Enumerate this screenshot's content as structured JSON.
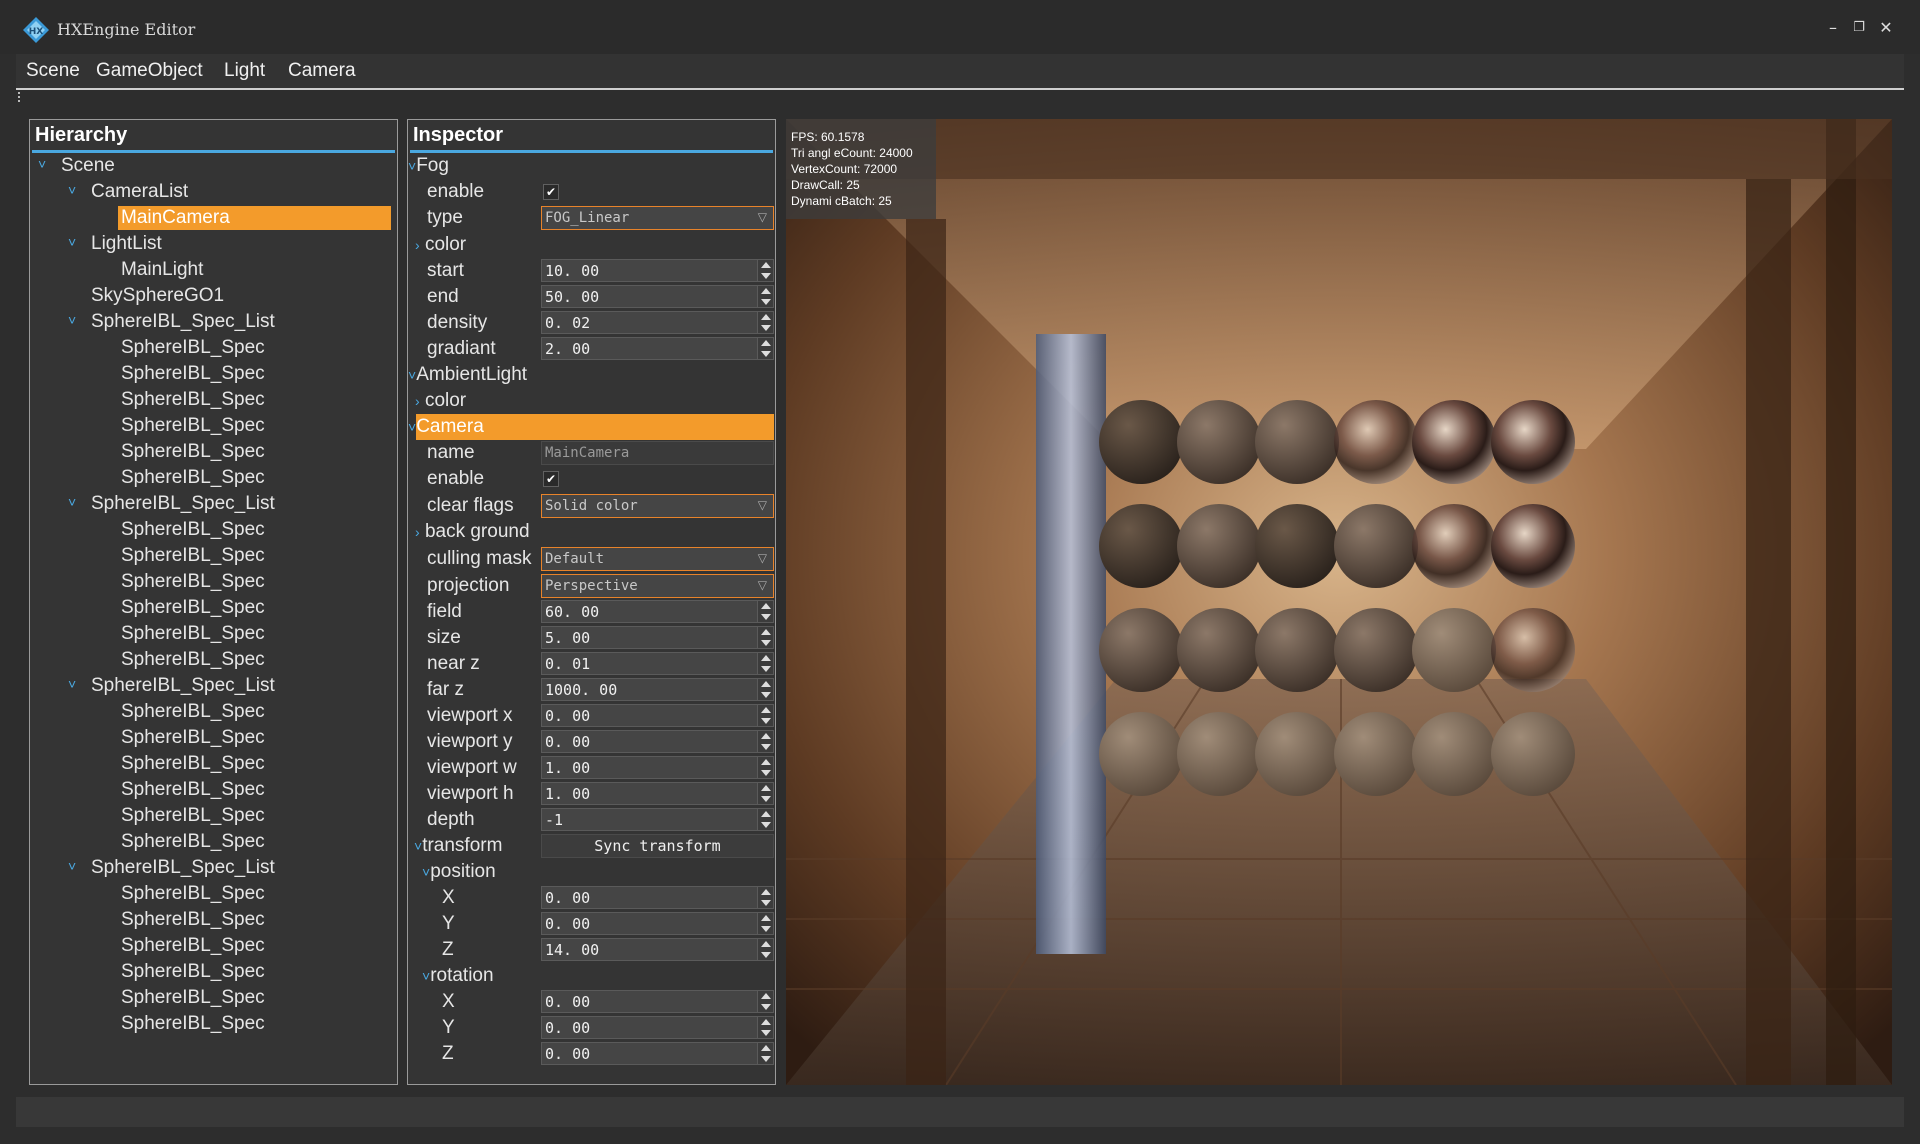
{
  "window": {
    "title": "HXEngine Editor",
    "minimize_icon": "minimize-icon",
    "restore_icon": "restore-icon",
    "close_icon": "close-icon"
  },
  "menu": [
    "Scene",
    "GameObject",
    "Light",
    "Camera"
  ],
  "hierarchy": {
    "title": "Hierarchy",
    "rows": [
      {
        "label": "Scene",
        "depth": 0,
        "expanded": true
      },
      {
        "label": "CameraList",
        "depth": 1,
        "expanded": true
      },
      {
        "label": "MainCamera",
        "depth": 2,
        "selected": true
      },
      {
        "label": "LightList",
        "depth": 1,
        "expanded": true
      },
      {
        "label": "MainLight",
        "depth": 2
      },
      {
        "label": "SkySphereGO1",
        "depth": 1
      },
      {
        "label": "SphereIBL_Spec_List",
        "depth": 1,
        "expanded": true
      },
      {
        "label": "SphereIBL_Spec",
        "depth": 2
      },
      {
        "label": "SphereIBL_Spec",
        "depth": 2
      },
      {
        "label": "SphereIBL_Spec",
        "depth": 2
      },
      {
        "label": "SphereIBL_Spec",
        "depth": 2
      },
      {
        "label": "SphereIBL_Spec",
        "depth": 2
      },
      {
        "label": "SphereIBL_Spec",
        "depth": 2
      },
      {
        "label": "SphereIBL_Spec_List",
        "depth": 1,
        "expanded": true
      },
      {
        "label": "SphereIBL_Spec",
        "depth": 2
      },
      {
        "label": "SphereIBL_Spec",
        "depth": 2
      },
      {
        "label": "SphereIBL_Spec",
        "depth": 2
      },
      {
        "label": "SphereIBL_Spec",
        "depth": 2
      },
      {
        "label": "SphereIBL_Spec",
        "depth": 2
      },
      {
        "label": "SphereIBL_Spec",
        "depth": 2
      },
      {
        "label": "SphereIBL_Spec_List",
        "depth": 1,
        "expanded": true
      },
      {
        "label": "SphereIBL_Spec",
        "depth": 2
      },
      {
        "label": "SphereIBL_Spec",
        "depth": 2
      },
      {
        "label": "SphereIBL_Spec",
        "depth": 2
      },
      {
        "label": "SphereIBL_Spec",
        "depth": 2
      },
      {
        "label": "SphereIBL_Spec",
        "depth": 2
      },
      {
        "label": "SphereIBL_Spec",
        "depth": 2
      },
      {
        "label": "SphereIBL_Spec_List",
        "depth": 1,
        "expanded": true
      },
      {
        "label": "SphereIBL_Spec",
        "depth": 2
      },
      {
        "label": "SphereIBL_Spec",
        "depth": 2
      },
      {
        "label": "SphereIBL_Spec",
        "depth": 2
      },
      {
        "label": "SphereIBL_Spec",
        "depth": 2
      },
      {
        "label": "SphereIBL_Spec",
        "depth": 2
      },
      {
        "label": "SphereIBL_Spec",
        "depth": 2
      }
    ]
  },
  "inspector": {
    "title": "Inspector",
    "fog": {
      "section": "Fog",
      "enable_label": "enable",
      "enable": true,
      "type_label": "type",
      "type": "FOG_Linear",
      "color_label": "color",
      "start_label": "start",
      "start": "10. 00",
      "end_label": "end",
      "end": "50. 00",
      "density_label": "density",
      "density": "0. 02",
      "gradiant_label": "gradiant",
      "gradiant": "2. 00"
    },
    "ambient": {
      "section": "AmbientLight",
      "color_label": "color"
    },
    "camera": {
      "section": "Camera",
      "name_label": "name",
      "name": "MainCamera",
      "enable_label": "enable",
      "enable": true,
      "clear_flags_label": "clear flags",
      "clear_flags": "Solid color",
      "background_label": "back ground",
      "culling_mask_label": "culling mask",
      "culling_mask": "Default",
      "projection_label": "projection",
      "projection": "Perspective",
      "field_label": "field",
      "field": "60. 00",
      "size_label": "size",
      "size": "5. 00",
      "near_label": "near z",
      "near": "0. 01",
      "far_label": "far z",
      "far": "1000. 00",
      "vx_label": "viewport x",
      "vx": "0. 00",
      "vy_label": "viewport y",
      "vy": "0. 00",
      "vw_label": "viewport w",
      "vw": "1. 00",
      "vh_label": "viewport h",
      "vh": "1. 00",
      "depth_label": "depth",
      "depth": "-1",
      "transform_label": "transform",
      "sync_button": "Sync transform",
      "position_label": "position",
      "px_label": "X",
      "px": "0. 00",
      "py_label": "Y",
      "py": "0. 00",
      "pz_label": "Z",
      "pz": "14. 00",
      "rotation_label": "rotation",
      "rx_label": "X",
      "rx": "0. 00",
      "ry_label": "Y",
      "ry": "0. 00",
      "rz_label": "Z",
      "rz": "0. 00"
    }
  },
  "stats": {
    "fps": "FPS: 60.1578",
    "triangles": "Tri angl eCount: 24000",
    "vertices": "VertexCount: 72000",
    "drawcalls": "DrawCall: 25",
    "batches": "Dynami cBatch: 25"
  },
  "colors": {
    "accent_blue": "#4aa8e0",
    "selection_orange": "#f39b2b"
  }
}
